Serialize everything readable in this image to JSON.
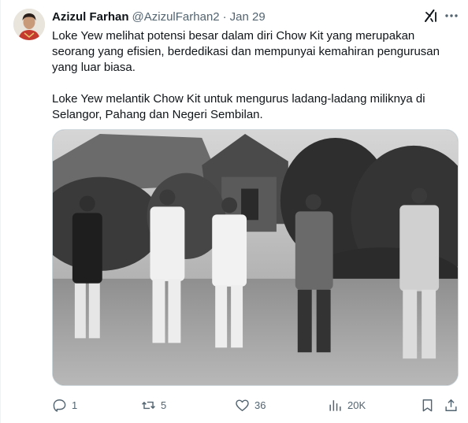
{
  "tweet": {
    "author": {
      "display_name": "Azizul Farhan",
      "handle": "@AzizulFarhan2",
      "separator": "·",
      "date": "Jan 29"
    },
    "paragraphs": [
      "Loke Yew melihat potensi besar dalam diri Chow Kit yang merupakan seorang yang efisien, berdedikasi dan mempunyai kemahiran pengurusan yang luar biasa.",
      "Loke Yew melantik Chow Kit untuk mengurus ladang-ladang miliknya di Selangor, Pahang dan Negeri Sembilan."
    ],
    "media": {
      "kind": "black-and-white historical photograph of five men standing in front of thatched huts and banana trees"
    },
    "actions": {
      "reply_count": "1",
      "repost_count": "5",
      "like_count": "36",
      "views_count": "20K"
    },
    "icons": {
      "grok": "grok-icon",
      "more": "more-icon",
      "reply": "reply-icon",
      "repost": "repost-icon",
      "like": "heart-icon",
      "views": "views-icon",
      "bookmark": "bookmark-icon",
      "share": "share-icon"
    },
    "colors": {
      "text_primary": "#0f1419",
      "text_secondary": "#536471",
      "border": "#cfd9de"
    }
  }
}
